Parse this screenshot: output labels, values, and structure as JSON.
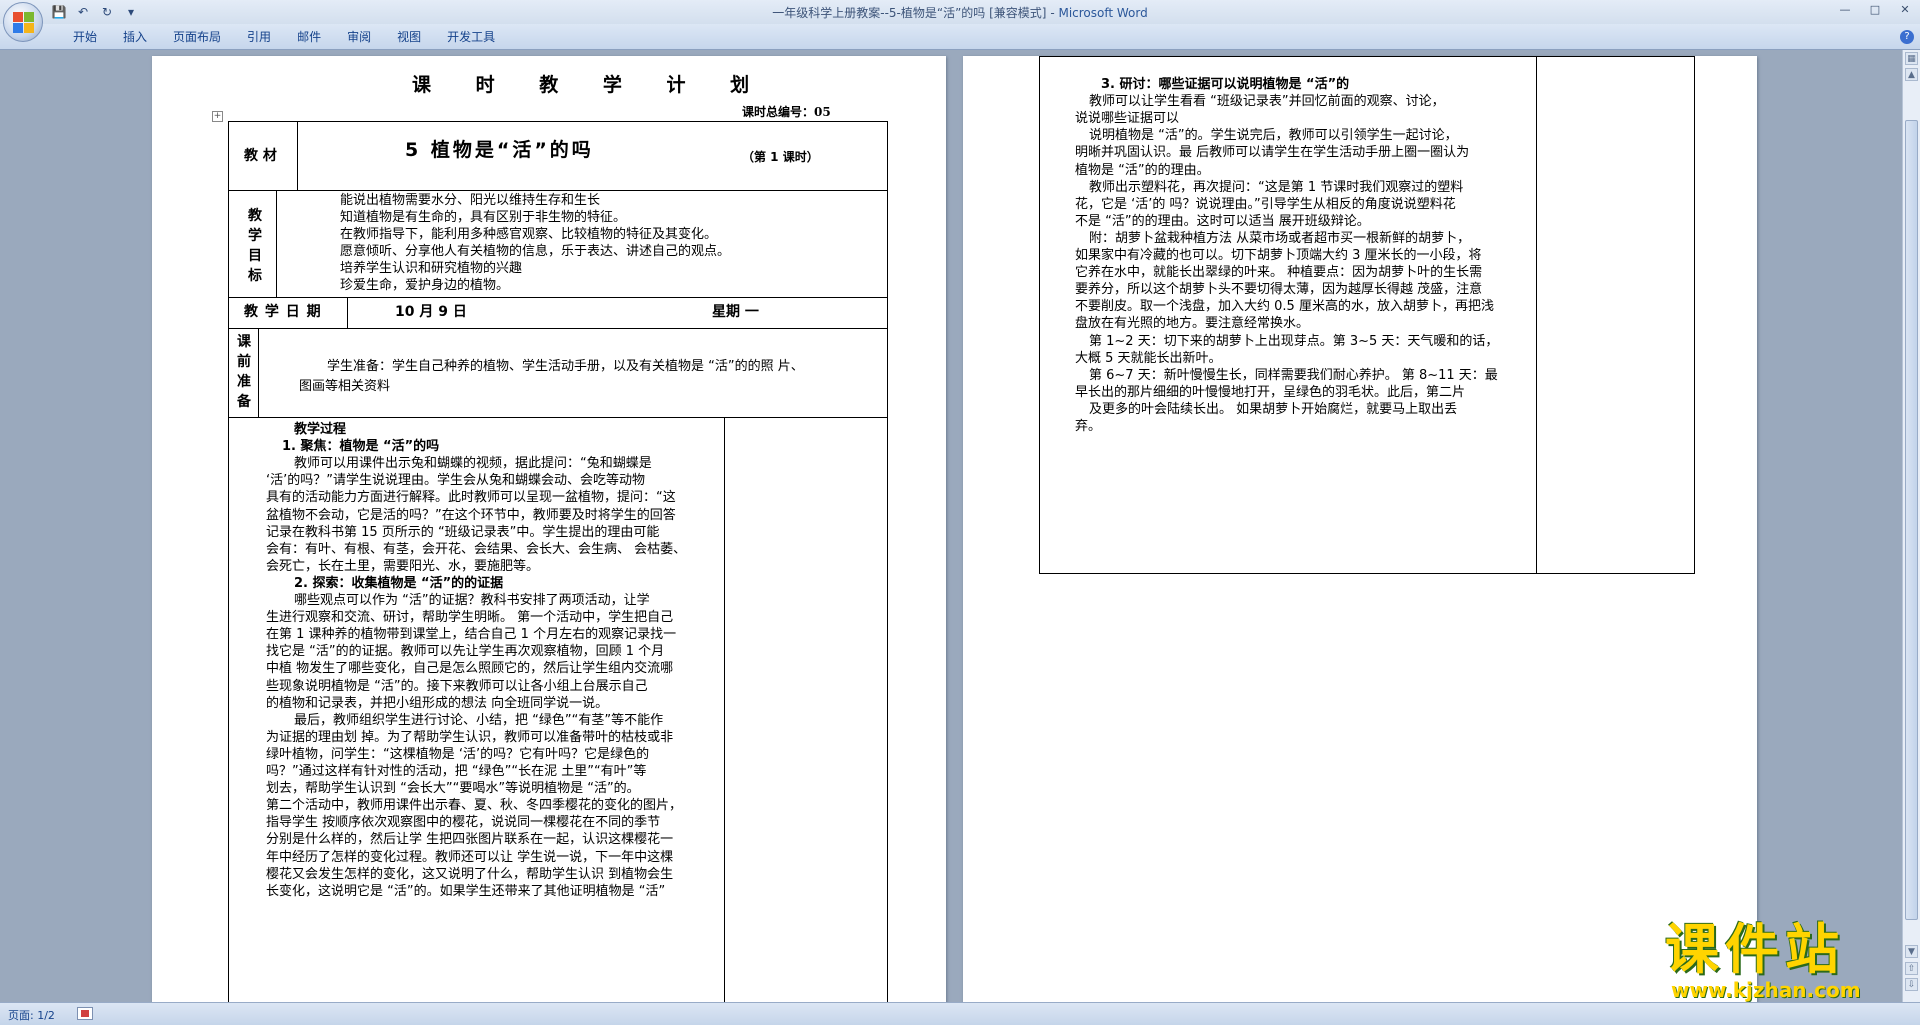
{
  "window": {
    "title_doc": "一年级科学上册教案--5-植物是“活”的吗 [兼容模式]",
    "title_sep": " - ",
    "title_app": "Microsoft Word"
  },
  "ribbon": {
    "tabs": [
      "开始",
      "插入",
      "页面布局",
      "引用",
      "邮件",
      "审阅",
      "视图",
      "开发工具"
    ]
  },
  "status": {
    "page": "页面: 1/2"
  },
  "watermark": {
    "title": "课件站",
    "url": "www.kjzhan.com"
  },
  "page1": {
    "heading": "课 时 教 学 计 划",
    "lesson_no": "课时总编号：05",
    "material_label": "教 材",
    "material_title": "5 植物是“活”的吗",
    "lesson_tag": "（第 1 课时）",
    "goals_label": [
      "教",
      "学",
      "目",
      "标"
    ],
    "goals": [
      "能说出植物需要水分、阳光以维持生存和生长",
      "知道植物是有生命的，具有区别于非生物的特征。",
      "在教师指导下，能利用多种感官观察、比较植物的特征及其变化。",
      "愿意倾听、分享他人有关植物的信息，乐于表达、讲述自己的观点。",
      "培养学生认识和研究植物的兴趣",
      "珍爱生命，爱护身边的植物。"
    ],
    "date_label": "教 学 日 期",
    "date_value": "10 月 9 日",
    "weekday": "星期 一",
    "prep_label": [
      "课",
      "前",
      "准",
      "备"
    ],
    "prep_lines": [
      "学生准备：学生自己种养的植物、学生活动手册，以及有关植物是 “活”的的照 片、",
      "图画等相关资料"
    ],
    "process_lines": [
      "教学过程",
      "1. 聚焦：植物是 “活”的吗",
      "教师可以用课件出示兔和蝴蝶的视频，据此提问：“兔和蝴蝶是",
      "‘活’的吗？”请学生说说理由。学生会从兔和蝴蝶会动、会吃等动物",
      "具有的活动能力方面进行解释。此时教师可以呈现一盆植物，提问：“这",
      "盆植物不会动，它是活的吗？”在这个环节中，教师要及时将学生的回答",
      "记录在教科书第 15 页所示的 “班级记录表”中。学生提出的理由可能",
      "会有：有叶、有根、有茎，会开花、会结果、会长大、会生病、 会枯萎、",
      "会死亡，长在土里，需要阳光、水，要施肥等。",
      "2. 探索：收集植物是 “活”的的证据",
      "哪些观点可以作为 “活”的证据？教科书安排了两项活动，让学",
      "生进行观察和交流、研讨，帮助学生明晰。 第一个活动中，学生把自己",
      "在第 1 课种养的植物带到课堂上，结合自己 1 个月左右的观察记录找一",
      "找它是 “活”的的证据。教师可以先让学生再次观察植物，回顾 1 个月",
      "中植 物发生了哪些变化，自己是怎么照顾它的，然后让学生组内交流哪",
      "些现象说明植物是 “活”的。接下来教师可以让各小组上台展示自己",
      "的植物和记录表，并把小组形成的想法 向全班同学说一说。",
      "最后，教师组织学生进行讨论、小结，把 “绿色”“有茎”等不能作",
      "为证据的理由划 掉。为了帮助学生认识，教师可以准备带叶的枯枝或非",
      "绿叶植物，问学生：“这棵植物是 ‘活’的吗？它有叶吗？它是绿色的",
      "吗？”通过这样有针对性的活动，把 “绿色”“长在泥 土里”“有叶”等",
      "划去，帮助学生认识到 “会长大”“要喝水”等说明植物是 “活”的。",
      "第二个活动中，教师用课件出示春、夏、秋、冬四季樱花的变化的图片，",
      "指导学生 按顺序依次观察图中的樱花，说说同一棵樱花在不同的季节",
      "分别是什么样的，然后让学 生把四张图片联系在一起，认识这棵樱花一",
      "年中经历了怎样的变化过程。教师还可以让 学生说一说，下一年中这棵",
      "樱花又会发生怎样的变化，这又说明了什么，帮助学生认识 到植物会生",
      "长变化，这说明它是 “活”的。如果学生还带来了其他证明植物是 “活”"
    ]
  },
  "page2": {
    "lines": [
      "3. 研讨：哪些证据可以说明植物是 “活”的",
      "教师可以让学生看看 “班级记录表”并回忆前面的观察、讨论，",
      "说说哪些证据可以",
      "说明植物是 “活”的。学生说完后，教师可以引领学生一起讨论，",
      "明晰并巩固认识。最 后教师可以请学生在学生活动手册上圈一圈认为",
      "植物是 “活”的的理由。",
      "教师出示塑料花，再次提问：“这是第 1 节课时我们观察过的塑料",
      "花，它是 ‘活’的 吗？说说理由。”引导学生从相反的角度说说塑料花",
      "不是 “活”的的理由。这时可以适当 展开班级辩论。",
      "附：胡萝卜盆栽种植方法 从菜市场或者超市买一根新鲜的胡萝卜，",
      "如果家中有冷藏的也可以。切下胡萝卜顶端大约 3 厘米长的一小段，将",
      "它养在水中，就能长出翠绿的叶来。 种植要点：因为胡萝卜叶的生长需",
      "要养分，所以这个胡萝卜头不要切得太薄，因为越厚长得越 茂盛，注意",
      "不要削皮。取一个浅盘，加入大约 0.5 厘米高的水，放入胡萝卜，再把浅",
      "盘放在有光照的地方。要注意经常换水。",
      "第 1~2 天：切下来的胡萝卜上出现芽点。第 3~5 天：天气暖和的话，",
      "大概 5 天就能长出新叶。",
      "第 6~7 天：新叶慢慢生长，同样需要我们耐心养护。 第 8~11 天：最",
      "早长出的那片细细的叶慢慢地打开，呈绿色的羽毛状。此后，第二片",
      "及更多的叶会陆续长出。 如果胡萝卜开始腐烂，就要马上取出丢",
      "弃。"
    ]
  }
}
